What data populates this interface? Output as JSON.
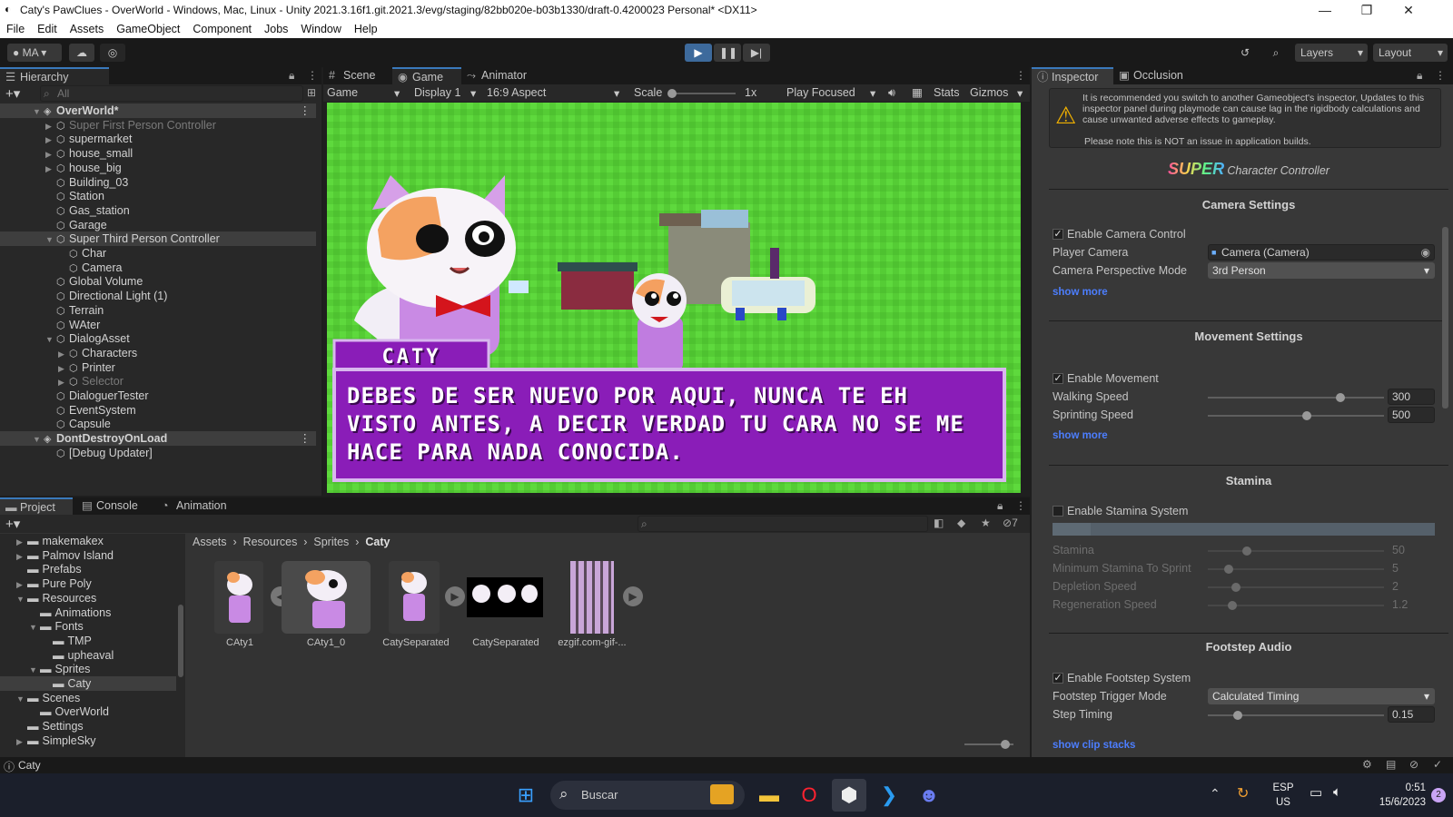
{
  "window": {
    "title": "Caty's PawClues - OverWorld - Windows, Mac, Linux - Unity 2021.3.16f1.git.2021.3/evg/staging/82bb020e-b03b1330/draft-0.4200023 Personal* <DX11>"
  },
  "menu": [
    "File",
    "Edit",
    "Assets",
    "GameObject",
    "Component",
    "Jobs",
    "Window",
    "Help"
  ],
  "toolbar": {
    "account": "MA",
    "layers": "Layers",
    "layout": "Layout"
  },
  "hierarchy": {
    "tab": "Hierarchy",
    "search_placeholder": "All",
    "items": [
      {
        "label": "OverWorld*",
        "depth": 0,
        "arrow": "▼",
        "type": "scene"
      },
      {
        "label": "Super First Person Controller",
        "depth": 1,
        "arrow": "▶",
        "type": "obj",
        "dim": true
      },
      {
        "label": "supermarket",
        "depth": 1,
        "arrow": "▶",
        "type": "obj"
      },
      {
        "label": "house_small",
        "depth": 1,
        "arrow": "▶",
        "type": "obj"
      },
      {
        "label": "house_big",
        "depth": 1,
        "arrow": "▶",
        "type": "obj"
      },
      {
        "label": "Building_03",
        "depth": 1,
        "arrow": "",
        "type": "obj"
      },
      {
        "label": "Station",
        "depth": 1,
        "arrow": "",
        "type": "obj"
      },
      {
        "label": "Gas_station",
        "depth": 1,
        "arrow": "",
        "type": "obj"
      },
      {
        "label": "Garage",
        "depth": 1,
        "arrow": "",
        "type": "obj"
      },
      {
        "label": "Super Third Person Controller",
        "depth": 1,
        "arrow": "▼",
        "type": "obj",
        "selected": true
      },
      {
        "label": "Char",
        "depth": 2,
        "arrow": "",
        "type": "obj"
      },
      {
        "label": "Camera",
        "depth": 2,
        "arrow": "",
        "type": "obj"
      },
      {
        "label": "Global Volume",
        "depth": 1,
        "arrow": "",
        "type": "obj"
      },
      {
        "label": "Directional Light (1)",
        "depth": 1,
        "arrow": "",
        "type": "obj"
      },
      {
        "label": "Terrain",
        "depth": 1,
        "arrow": "",
        "type": "obj"
      },
      {
        "label": "WAter",
        "depth": 1,
        "arrow": "",
        "type": "obj"
      },
      {
        "label": "DialogAsset",
        "depth": 1,
        "arrow": "▼",
        "type": "obj"
      },
      {
        "label": "Characters",
        "depth": 2,
        "arrow": "▶",
        "type": "obj"
      },
      {
        "label": "Printer",
        "depth": 2,
        "arrow": "▶",
        "type": "obj"
      },
      {
        "label": "Selector",
        "depth": 2,
        "arrow": "▶",
        "type": "obj",
        "dim": true
      },
      {
        "label": "DialoguerTester",
        "depth": 1,
        "arrow": "",
        "type": "obj"
      },
      {
        "label": "EventSystem",
        "depth": 1,
        "arrow": "",
        "type": "obj"
      },
      {
        "label": "Capsule",
        "depth": 1,
        "arrow": "",
        "type": "obj"
      },
      {
        "label": "DontDestroyOnLoad",
        "depth": 0,
        "arrow": "▼",
        "type": "scene"
      },
      {
        "label": "[Debug Updater]",
        "depth": 1,
        "arrow": "",
        "type": "obj"
      }
    ]
  },
  "gameview": {
    "tabs": [
      "Scene",
      "Game",
      "Animator"
    ],
    "game_dropdown": "Game",
    "display": "Display 1",
    "aspect": "16:9 Aspect",
    "scale_label": "Scale",
    "scale_value": "1x",
    "play_mode": "Play Focused",
    "stats": "Stats",
    "gizmos": "Gizmos",
    "dialog_name": "CATY",
    "dialog_text": "DEBES DE SER NUEVO POR AQUI, NUNCA TE EH VISTO ANTES, A DECIR VERDAD TU CARA NO SE ME HACE PARA NADA CONOCIDA."
  },
  "inspector": {
    "tabs": [
      "Inspector",
      "Occlusion"
    ],
    "warning": "It is recommended you switch to another Gameobject's inspector, Updates to this inspector panel during playmode can cause lag in the rigidbody calculations and cause unwanted adverse effects to gameplay.",
    "warning_note": "Please note this is NOT an issue in application builds.",
    "brand_super": "SUPER",
    "brand_rest": "Character Controller",
    "camera": {
      "header": "Camera Settings",
      "enable": "Enable Camera Control",
      "player_camera_label": "Player Camera",
      "player_camera_value": "Camera (Camera)",
      "perspective_label": "Camera Perspective Mode",
      "perspective_value": "3rd Person",
      "show_more": "show more"
    },
    "movement": {
      "header": "Movement Settings",
      "enable": "Enable Movement",
      "walking_label": "Walking Speed",
      "walking_value": "300",
      "walking_fraction": 0.75,
      "sprinting_label": "Sprinting Speed",
      "sprinting_value": "500",
      "sprinting_fraction": 0.56,
      "show_more": "show more"
    },
    "stamina": {
      "header": "Stamina",
      "enable": "Enable Stamina System",
      "stamina_label": "Stamina",
      "stamina_value": "50",
      "stamina_fraction": 0.22,
      "min_label": "Minimum Stamina To Sprint",
      "min_value": "5",
      "min_fraction": 0.12,
      "depletion_label": "Depletion Speed",
      "depletion_value": "2",
      "depletion_fraction": 0.16,
      "regen_label": "Regeneration Speed",
      "regen_value": "1.2",
      "regen_fraction": 0.14
    },
    "footstep": {
      "header": "Footstep Audio",
      "enable": "Enable Footstep System",
      "trigger_label": "Footstep Trigger Mode",
      "trigger_value": "Calculated Timing",
      "timing_label": "Step Timing",
      "timing_value": "0.15",
      "timing_fraction": 0.17,
      "show_clip": "show clip stacks"
    }
  },
  "project": {
    "tabs": [
      "Project",
      "Console",
      "Animation"
    ],
    "breadcrumb": [
      "Assets",
      "Resources",
      "Sprites",
      "Caty"
    ],
    "hidden_count": "7",
    "tree": [
      {
        "label": "makemakex",
        "depth": 0,
        "arrow": "▶"
      },
      {
        "label": "Palmov Island",
        "depth": 0,
        "arrow": "▶"
      },
      {
        "label": "Prefabs",
        "depth": 0,
        "arrow": ""
      },
      {
        "label": "Pure Poly",
        "depth": 0,
        "arrow": "▶"
      },
      {
        "label": "Resources",
        "depth": 0,
        "arrow": "▼"
      },
      {
        "label": "Animations",
        "depth": 1,
        "arrow": ""
      },
      {
        "label": "Fonts",
        "depth": 1,
        "arrow": "▼"
      },
      {
        "label": "TMP",
        "depth": 2,
        "arrow": ""
      },
      {
        "label": "upheaval",
        "depth": 2,
        "arrow": ""
      },
      {
        "label": "Sprites",
        "depth": 1,
        "arrow": "▼"
      },
      {
        "label": "Caty",
        "depth": 2,
        "arrow": "",
        "selected": true
      },
      {
        "label": "Scenes",
        "depth": 0,
        "arrow": "▼"
      },
      {
        "label": "OverWorld",
        "depth": 1,
        "arrow": ""
      },
      {
        "label": "Settings",
        "depth": 0,
        "arrow": ""
      },
      {
        "label": "SimpleSky",
        "depth": 0,
        "arrow": "▶"
      }
    ],
    "assets": [
      "CAty1",
      "CAty1_0",
      "CatySeparated",
      "CatySeparated",
      "ezgif.com-gif-..."
    ]
  },
  "statusbar": {
    "text": "Caty"
  },
  "taskbar": {
    "search": "Buscar",
    "lang1": "ESP",
    "lang2": "US",
    "time": "0:51",
    "date": "15/6/2023",
    "notif": "2"
  }
}
